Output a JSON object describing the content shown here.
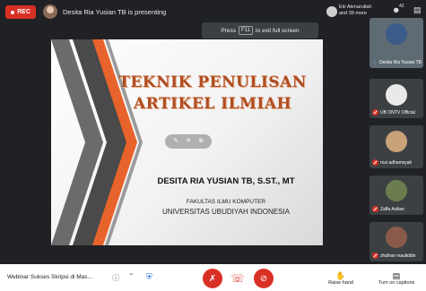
{
  "topbar": {
    "rec_label": "REC",
    "presenting_text": "Desita Ria Yusian TB is presenting",
    "viewers_name": "Eki Akmarullah",
    "viewers_more": "and 39 more",
    "people_count": "42"
  },
  "tooltip": {
    "prefix": "Press",
    "key": "F11",
    "suffix": "to exit full screen"
  },
  "slide": {
    "title_line1": "TEKNIK PENULISAN",
    "title_line2": "ARTIKEL ILMIAH",
    "author": "DESITA RIA YUSIAN TB, S.ST., MT",
    "faculty": "FAKULTAS ILMU KOMPUTER",
    "university": "UNIVERSITAS UBUDIYAH INDONESIA"
  },
  "participants": [
    {
      "name": "Desita Ria Yusian TB"
    },
    {
      "name": "UB ONTV Official"
    },
    {
      "name": "rozi adhamsyah"
    },
    {
      "name": "Zaffa Ardian"
    },
    {
      "name": "zhafran mauliddin"
    }
  ],
  "bottombar": {
    "meeting_name": "Webinar Sukses Skripsi di Mas...",
    "raise_hand_label": "Raise hand",
    "captions_label": "Turn on captions"
  },
  "colors": {
    "accent_red": "#d93025",
    "title_orange": "#b04e22",
    "deco_orange": "#e8632b",
    "deco_gray": "#595959"
  },
  "icons": [
    "mic-off-icon",
    "hang-up-icon",
    "camera-off-icon",
    "raise-hand-icon",
    "captions-icon",
    "people-icon",
    "chat-icon",
    "shield-icon",
    "info-icon",
    "chevron-up-icon",
    "pen-icon",
    "eraser-icon",
    "close-circle-icon"
  ]
}
